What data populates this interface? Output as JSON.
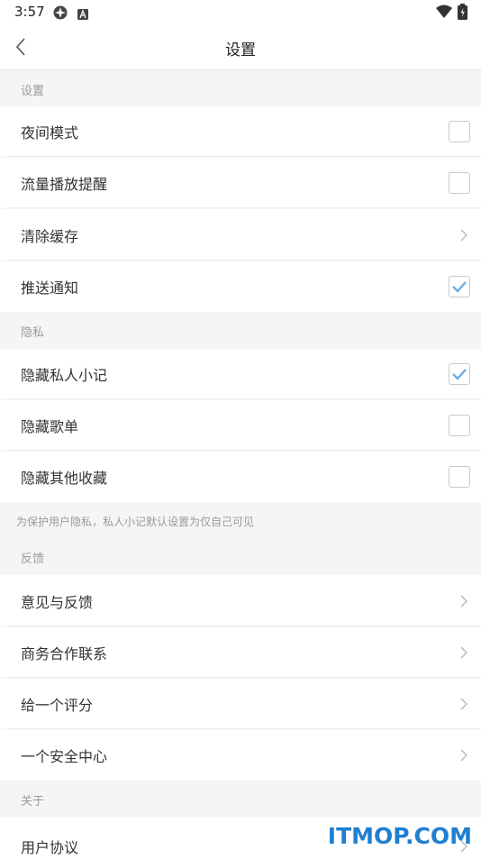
{
  "status_bar": {
    "time": "3:57"
  },
  "header": {
    "title": "设置"
  },
  "sections": {
    "settings": {
      "title": "设置",
      "night_mode": "夜间模式",
      "data_reminder": "流量播放提醒",
      "clear_cache": "清除缓存",
      "push_notify": "推送通知"
    },
    "privacy": {
      "title": "隐私",
      "hide_notes": "隐藏私人小记",
      "hide_playlists": "隐藏歌单",
      "hide_favorites": "隐藏其他收藏",
      "note": "为保护用户隐私，私人小记默认设置为仅自己可见"
    },
    "feedback": {
      "title": "反馈",
      "suggestions": "意见与反馈",
      "business": "商务合作联系",
      "rate": "给一个评分",
      "security": "一个安全中心"
    },
    "about": {
      "title": "关于",
      "agreement": "用户协议"
    }
  },
  "states": {
    "night_mode": false,
    "data_reminder": false,
    "push_notify": true,
    "hide_notes": true,
    "hide_playlists": false,
    "hide_favorites": false
  },
  "colors": {
    "check": "#6aaee6",
    "watermark": "#1f7fd0"
  },
  "watermark": "ITMOP.COM"
}
